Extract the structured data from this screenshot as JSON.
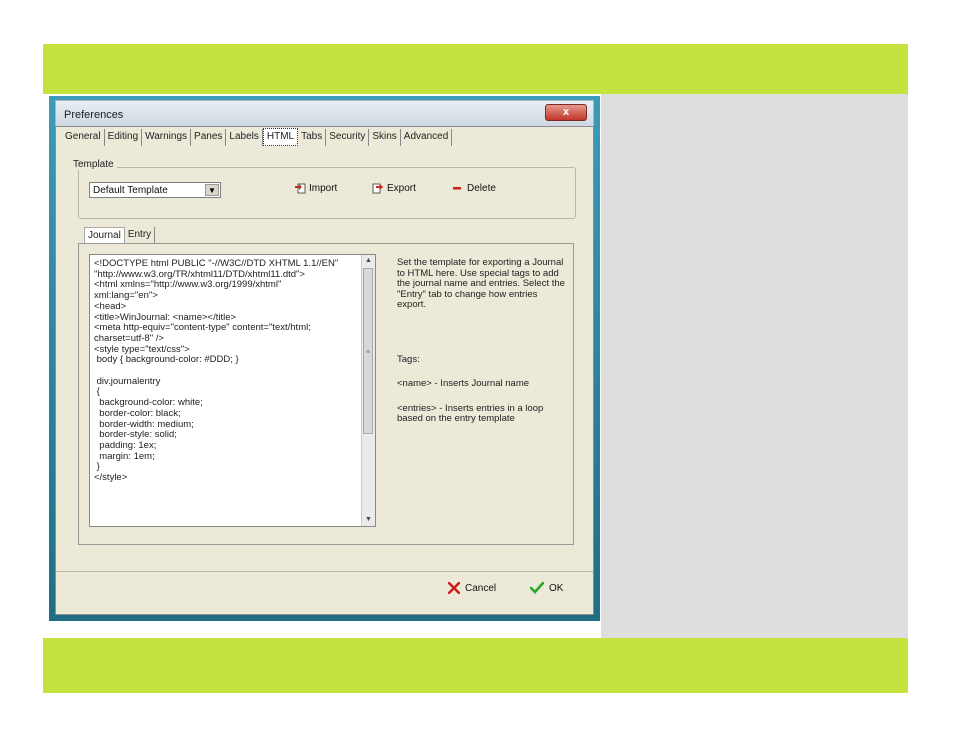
{
  "window": {
    "title": "Preferences",
    "close_label": "x"
  },
  "tabs": [
    "General",
    "Editing",
    "Warnings",
    "Panes",
    "Labels",
    "HTML",
    "Tabs",
    "Security",
    "Skins",
    "Advanced"
  ],
  "template_group": {
    "title": "Template",
    "selected": "Default Template",
    "import_label": "Import",
    "export_label": "Export",
    "delete_label": "Delete"
  },
  "subtabs": [
    "Journal",
    "Entry"
  ],
  "code": "<!DOCTYPE html PUBLIC \"-//W3C//DTD XHTML 1.1//EN\"\n\"http://www.w3.org/TR/xhtml11/DTD/xhtml11.dtd\">\n<html xmlns=\"http://www.w3.org/1999/xhtml\"\nxml:lang=\"en\">\n<head>\n<title>WinJournal: <name></title>\n<meta http-equiv=\"content-type\" content=\"text/html;\ncharset=utf-8\" />\n<style type=\"text/css\">\n body { background-color: #DDD; }\n\n div.journalentry\n {\n  background-color: white;\n  border-color: black;\n  border-width: medium;\n  border-style: solid;\n  padding: 1ex;\n  margin: 1em;\n }\n</style>",
  "help": {
    "intro": "Set the template for exporting a Journal to HTML here.  Use special tags to add the journal name and entries.  Select the \"Entry\" tab to change how entries export.",
    "tags_heading": "Tags:",
    "tag_name": "<name> - Inserts Journal name",
    "tag_entries": "<entries> - Inserts entries in a loop based on the entry template"
  },
  "buttons": {
    "cancel": "Cancel",
    "ok": "OK"
  },
  "colors": {
    "band": "#c5e33e",
    "panel": "#dedede"
  }
}
